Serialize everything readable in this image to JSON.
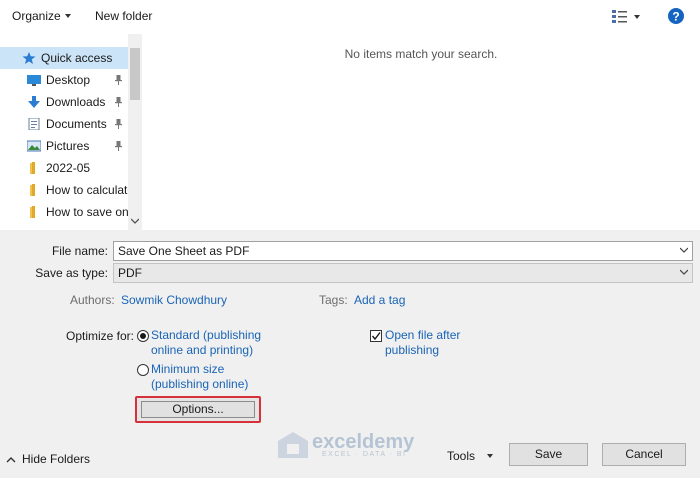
{
  "toolbar": {
    "organize_label": "Organize",
    "new_folder_label": "New folder",
    "view_icon": "view-details-icon",
    "help_icon": "help-icon"
  },
  "nav": {
    "items": [
      {
        "label": "Quick access",
        "icon": "star-icon",
        "pinned": false
      },
      {
        "label": "Desktop",
        "icon": "desktop-icon",
        "pinned": true
      },
      {
        "label": "Downloads",
        "icon": "download-icon",
        "pinned": true
      },
      {
        "label": "Documents",
        "icon": "documents-icon",
        "pinned": true
      },
      {
        "label": "Pictures",
        "icon": "pictures-icon",
        "pinned": true
      },
      {
        "label": "2022-05",
        "icon": "folder-icon",
        "pinned": false
      },
      {
        "label": "How to calculate",
        "icon": "folder-icon",
        "pinned": false
      },
      {
        "label": "How to save one",
        "icon": "folder-icon",
        "pinned": false
      }
    ]
  },
  "content": {
    "empty_message": "No items match your search."
  },
  "form": {
    "file_name_label": "File name:",
    "file_name_value": "Save One Sheet as PDF",
    "save_as_type_label": "Save as type:",
    "save_as_type_value": "PDF",
    "authors_label": "Authors:",
    "authors_value": "Sowmik Chowdhury",
    "tags_label": "Tags:",
    "tags_value": "Add a tag",
    "optimize_label": "Optimize for:",
    "standard_line1": "Standard (publishing",
    "standard_line2": "online and printing)",
    "minimum_line1": "Minimum size",
    "minimum_line2": "(publishing online)",
    "open_after_line1": "Open file after",
    "open_after_line2": "publishing",
    "options_label": "Options..."
  },
  "footer": {
    "hide_folders_label": "Hide Folders",
    "tools_label": "Tools",
    "save_label": "Save",
    "cancel_label": "Cancel"
  },
  "watermark": {
    "name": "exceldemy",
    "tagline": "EXCEL · DATA · BI"
  },
  "colors": {
    "link": "#1a64b6",
    "selection": "#cce4f7",
    "highlight_border": "#d6313b",
    "help": "#1565c0"
  }
}
